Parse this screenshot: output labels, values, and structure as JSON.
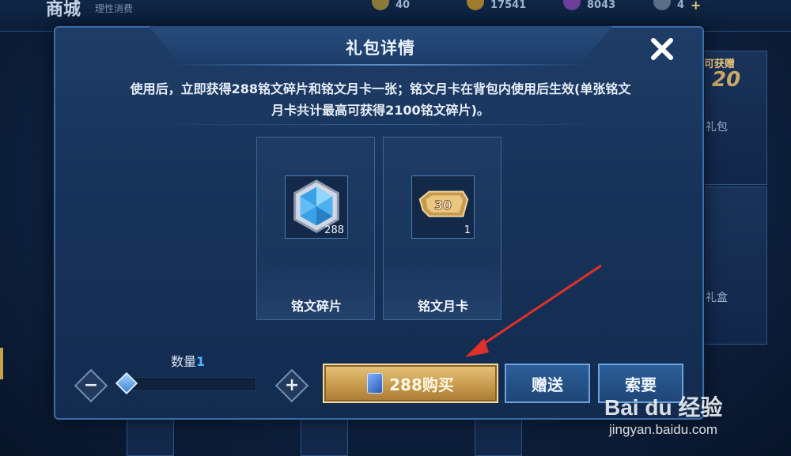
{
  "background": {
    "store_title": "商城",
    "store_subtitle": "理性消费",
    "resources": [
      {
        "icon": "gold-coin-icon",
        "value": "40"
      },
      {
        "icon": "diamond-coin-icon",
        "value": "17541"
      },
      {
        "icon": "gem-icon",
        "value": "8043"
      },
      {
        "icon": "ticket-icon",
        "value": "4"
      }
    ],
    "side_tag": "可获赠",
    "side_number": "20",
    "side_text_1": "礼包",
    "side_text_2": "礼盒"
  },
  "dialog": {
    "title": "礼包详情",
    "close_icon": "close-icon",
    "description_line1": "使用后，立即获得288铭文碎片和铭文月卡一张；铭文月卡在背包内使用后生效(单张铭文",
    "description_line2": "月卡共计最高可获得2100铭文碎片)。",
    "items": [
      {
        "name": "铭文碎片",
        "count": "288",
        "icon": "inscription-fragment-icon"
      },
      {
        "name": "铭文月卡",
        "count": "1",
        "icon": "inscription-monthly-card-icon",
        "badge": "30"
      }
    ],
    "quantity": {
      "label": "数量",
      "value": "1",
      "level": 0.0
    },
    "buy_button": "288购买",
    "gift_button": "赠送",
    "request_button": "索要"
  },
  "colors": {
    "accent_gold": "#c99b4d",
    "accent_blue": "#4fb1ff",
    "annotation_arrow": "#e0302a"
  },
  "watermark": {
    "logo": "Bai du 经验",
    "url": "jingyan.baidu.com"
  }
}
